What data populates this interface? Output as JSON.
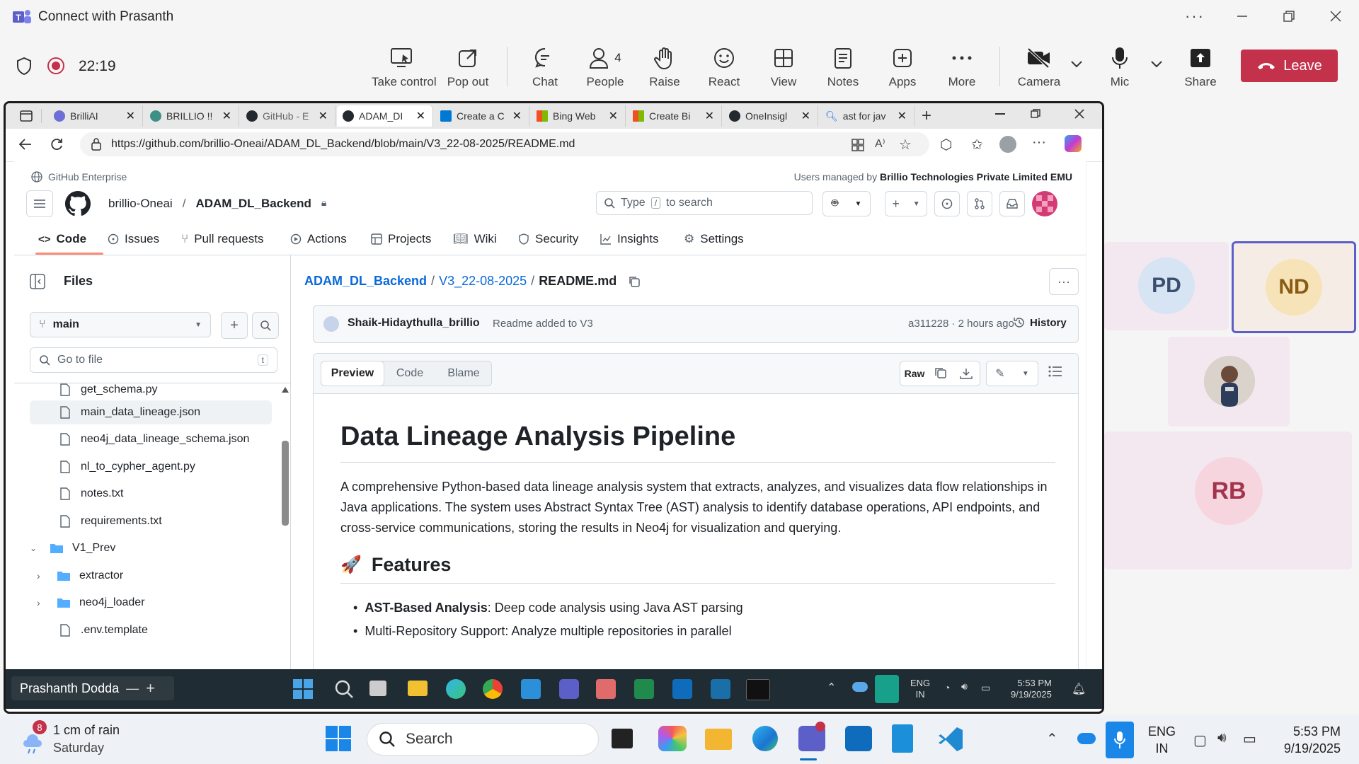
{
  "window": {
    "title": "Connect with Prasanth"
  },
  "meeting": {
    "elapsed": "22:19",
    "buttons": [
      {
        "label": "Take control"
      },
      {
        "label": "Pop out"
      },
      {
        "label": "Chat"
      },
      {
        "label": "People",
        "count": "4"
      },
      {
        "label": "Raise"
      },
      {
        "label": "React"
      },
      {
        "label": "View"
      },
      {
        "label": "Notes"
      },
      {
        "label": "Apps"
      },
      {
        "label": "More"
      },
      {
        "label": "Camera"
      },
      {
        "label": "Mic"
      },
      {
        "label": "Share"
      }
    ],
    "leave_label": "Leave",
    "leave_color": "#c4314b"
  },
  "participants": [
    {
      "initials": "PD",
      "bg": "#d6e4f3"
    },
    {
      "initials": "ND",
      "bg": "#f7e3b8",
      "active": true
    },
    {
      "initials": "",
      "photo": true
    },
    {
      "initials": "RB",
      "bg": "#f6d5de"
    }
  ],
  "browser": {
    "tabs": [
      {
        "label": "BrilliAI"
      },
      {
        "label": "BRILLIO !!"
      },
      {
        "label": "GitHub - E"
      },
      {
        "label": "ADAM_DI"
      },
      {
        "label": "Create a C"
      },
      {
        "label": "Bing Web"
      },
      {
        "label": "Create Bi"
      },
      {
        "label": "OneInsigl"
      },
      {
        "label": "ast for jav"
      }
    ],
    "url": "https://github.com/brillio-Oneai/ADAM_DL_Backend/blob/main/V3_22-08-2025/README.md"
  },
  "github": {
    "enterprise": "GitHub Enterprise",
    "managed_prefix": "Users managed by",
    "managed_org": "Brillio Technologies Private Limited EMU",
    "owner": "brillio-Oneai",
    "repo": "ADAM_DL_Backend",
    "search_placeholder_a": "Type",
    "search_key": "/",
    "search_placeholder_b": "to search",
    "nav": [
      "Code",
      "Issues",
      "Pull requests",
      "Actions",
      "Projects",
      "Wiki",
      "Security",
      "Insights",
      "Settings"
    ],
    "files_title": "Files",
    "branch": "main",
    "go_to_file": "Go to file",
    "go_to_file_key": "t",
    "tree": [
      {
        "name": "get_schema.py",
        "type": "file",
        "indent": 1
      },
      {
        "name": "main_data_lineage.json",
        "type": "file",
        "indent": 1,
        "selected": true
      },
      {
        "name": "neo4j_data_lineage_schema.json",
        "type": "file",
        "indent": 1
      },
      {
        "name": "nl_to_cypher_agent.py",
        "type": "file",
        "indent": 1
      },
      {
        "name": "notes.txt",
        "type": "file",
        "indent": 1
      },
      {
        "name": "requirements.txt",
        "type": "file",
        "indent": 1
      },
      {
        "name": "V1_Prev",
        "type": "folder-open",
        "indent": 0
      },
      {
        "name": "extractor",
        "type": "folder",
        "indent": 1
      },
      {
        "name": "neo4j_loader",
        "type": "folder",
        "indent": 1
      },
      {
        "name": ".env.template",
        "type": "file",
        "indent": 1
      }
    ],
    "breadcrumb": {
      "repo": "ADAM_DL_Backend",
      "folder": "V3_22-08-2025",
      "file": "README.md",
      "sep": "/"
    },
    "commit": {
      "author": "Shaik-Hidaythulla_brillio",
      "message": "Readme added to V3",
      "meta": "a311228 · 2 hours ago",
      "history": "History"
    },
    "view_tabs": [
      "Preview",
      "Code",
      "Blame"
    ],
    "raw_label": "Raw",
    "readme": {
      "title": "Data Lineage Analysis Pipeline",
      "intro": "A comprehensive Python-based data lineage analysis system that extracts, analyzes, and visualizes data flow relationships in Java applications. The system uses Abstract Syntax Tree (AST) analysis to identify database operations, API endpoints, and cross-service communications, storing the results in Neo4j for visualization and querying.",
      "features_emoji": "🚀",
      "features_title": "Features",
      "bullet_bold": "AST-Based Analysis",
      "bullet_rest": ": Deep code analysis using Java AST parsing",
      "bullet2_partial": "Multi-Repository Support: Analyze multiple repositories in parallel"
    }
  },
  "shared_taskbar": {
    "presenter": "Prashanth Dodda",
    "lang": "ENG",
    "region": "IN",
    "time": "5:53 PM",
    "date": "9/19/2025"
  },
  "taskbar": {
    "weather_badge": "8",
    "weather": "1 cm of rain",
    "day": "Saturday",
    "search": "Search",
    "lang": "ENG",
    "region": "IN",
    "time": "5:53 PM",
    "date": "9/19/2025"
  }
}
